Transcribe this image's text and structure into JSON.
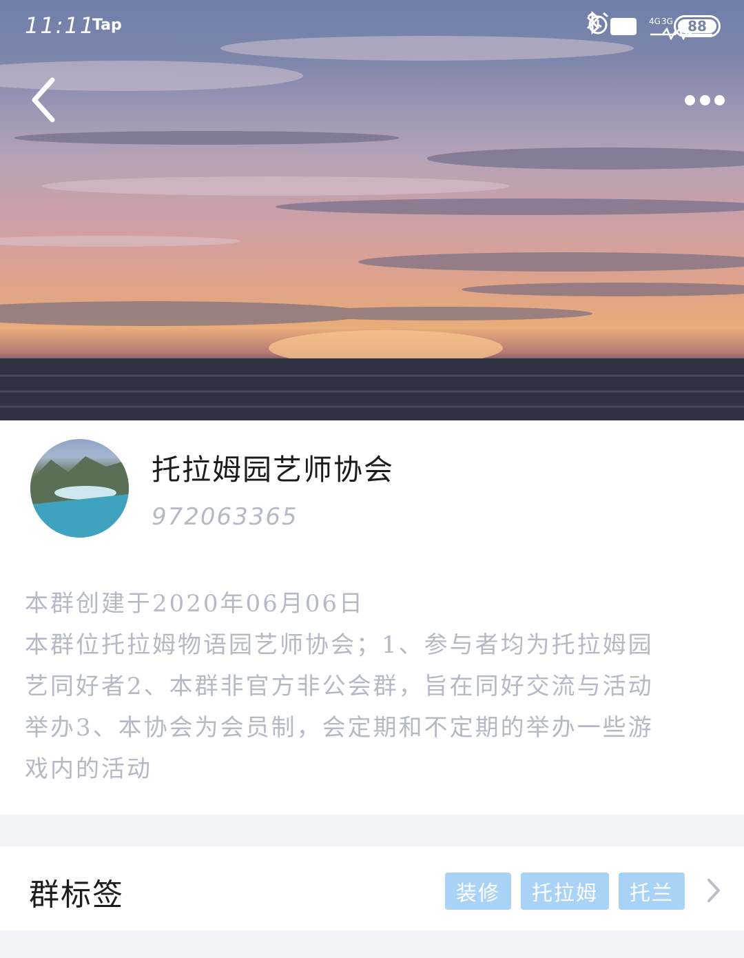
{
  "status_bar": {
    "time": "11:11",
    "app": "Tap",
    "hd": "HD",
    "net1": "4G",
    "net2": "3G",
    "battery": "88"
  },
  "header": {
    "back_icon": "chevron-left-icon",
    "more_icon": "more-dots-icon"
  },
  "group": {
    "name": "托拉姆园艺师协会",
    "id": "972063365",
    "description_lines": [
      "本群创建于2020年06月06日",
      "本群位托拉姆物语园艺师协会；1、参与者均为托拉姆园",
      "艺同好者2、本群非官方非公会群，旨在同好交流与活动",
      "举办3、本协会为会员制，会定期和不定期的举办一些游",
      "戏内的活动"
    ]
  },
  "tags_section": {
    "title": "群标签",
    "tags": [
      "装修",
      "托拉姆",
      "托兰"
    ]
  },
  "colors": {
    "tag_bg": "#a9d3f6",
    "muted_text": "#b4b9c5",
    "page_bg": "#f2f3f6"
  }
}
